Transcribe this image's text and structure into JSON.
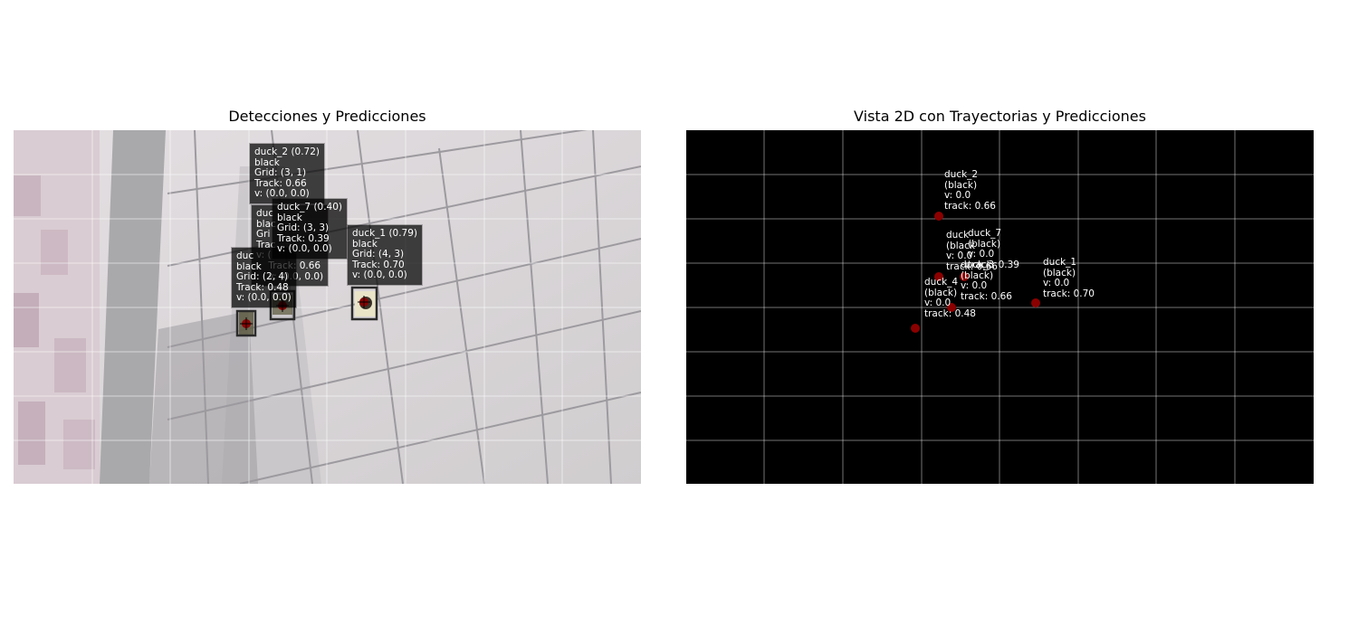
{
  "figure": {
    "left_panel": {
      "title": "Detecciones y Predicciones",
      "detections": [
        {
          "id": "duck_2",
          "label": "duck_2 (0.72)\nblack\nGrid: (3, 1)\nTrack: 0.66\nv: (0.0, 0.0)"
        },
        {
          "id": "duck_6",
          "label": "duc\nblac\nGri\nTrac\nv: (\n    Track: 0.66\n    v: (0.0, 0.0)"
        },
        {
          "id": "duck_7",
          "label": "duck_7 (0.40)\nblack\nGrid: (3, 3)\nTrack: 0.39\nv: (0.0, 0.0)"
        },
        {
          "id": "duck_1",
          "label": "duck_1 (0.79)\nblack\nGrid: (4, 3)\nTrack: 0.70\nv: (0.0, 0.0)"
        },
        {
          "id": "duck_4",
          "label": "duc\nblack\nGrid: (2, 4)\nTrack: 0.48\nv: (0.0, 0.0)"
        }
      ]
    },
    "right_panel": {
      "title": "Vista 2D con Trayectorias y Predicciones",
      "tracks": [
        {
          "id": "duck_2",
          "label": "duck_2\n(black)\nv: 0.0\ntrack: 0.66"
        },
        {
          "id": "duck_7",
          "label": "duck_7\n(black)\nv: 0.0\ntrack: 0.39"
        },
        {
          "id": "duck_6",
          "label": "duck\n(black\nv: 0.0\ntrack: 0.66"
        },
        {
          "id": "duck_3",
          "label": "duck_3\n(black)\nv: 0.0\ntrack: 0.66"
        },
        {
          "id": "duck_1",
          "label": "duck_1\n(black)\nv: 0.0\ntrack: 0.70"
        },
        {
          "id": "duck_4",
          "label": "duck_4\n(black)\nv: 0.0\ntrack: 0.48"
        }
      ]
    },
    "colors": {
      "marker": "#8b0000",
      "box": "#222222",
      "grid": "#ffffff",
      "map_bg": "#000000"
    }
  }
}
